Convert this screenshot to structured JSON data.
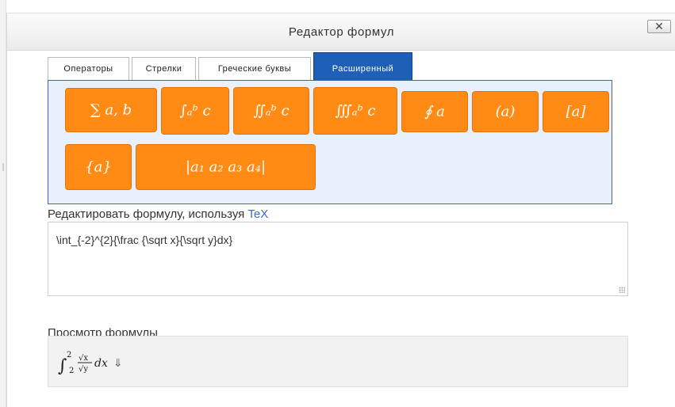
{
  "dialog": {
    "title": "Редактор формул",
    "close_symbol": "✕"
  },
  "tabs": [
    "Операторы",
    "Стрелки",
    "Греческие буквы",
    "Расширенный"
  ],
  "active_tab": "Расширенный",
  "operator_buttons": [
    {
      "name": "sum-a-b",
      "label": "∑ a, b"
    },
    {
      "name": "integral-a-b-c",
      "label": "∫ₐᵇ c"
    },
    {
      "name": "double-integral-a-b-c",
      "label": "∬ₐᵇ c"
    },
    {
      "name": "triple-integral-a-b-c",
      "label": "∭ₐᵇ c"
    },
    {
      "name": "contour-integral-a",
      "label": "∮ a"
    },
    {
      "name": "parentheses-a",
      "label": "(a)"
    },
    {
      "name": "brackets-a",
      "label": "[a]"
    },
    {
      "name": "braces-a",
      "label": "{a}"
    },
    {
      "name": "determinant-a",
      "label": "|a₁   a₂ a₃   a₄|"
    }
  ],
  "editor": {
    "label_prefix": "Редактировать формулу, используя ",
    "label_link": "TeX",
    "value": "\\int_{-2}^{2}{\\frac {\\sqrt x}{\\sqrt y}dx}"
  },
  "preview": {
    "label": "Просмотр формулы",
    "formula_parts": {
      "integral": "∫",
      "upper": "2",
      "lower": "2",
      "numerator": "√x",
      "denominator": "√y",
      "differential": "dx",
      "arrow": "⇓"
    }
  },
  "colors": {
    "button": "#ff8a14",
    "active_tab": "#1e5fb8",
    "panel_bg": "#e8f0fb",
    "link": "#3b6bbf"
  }
}
